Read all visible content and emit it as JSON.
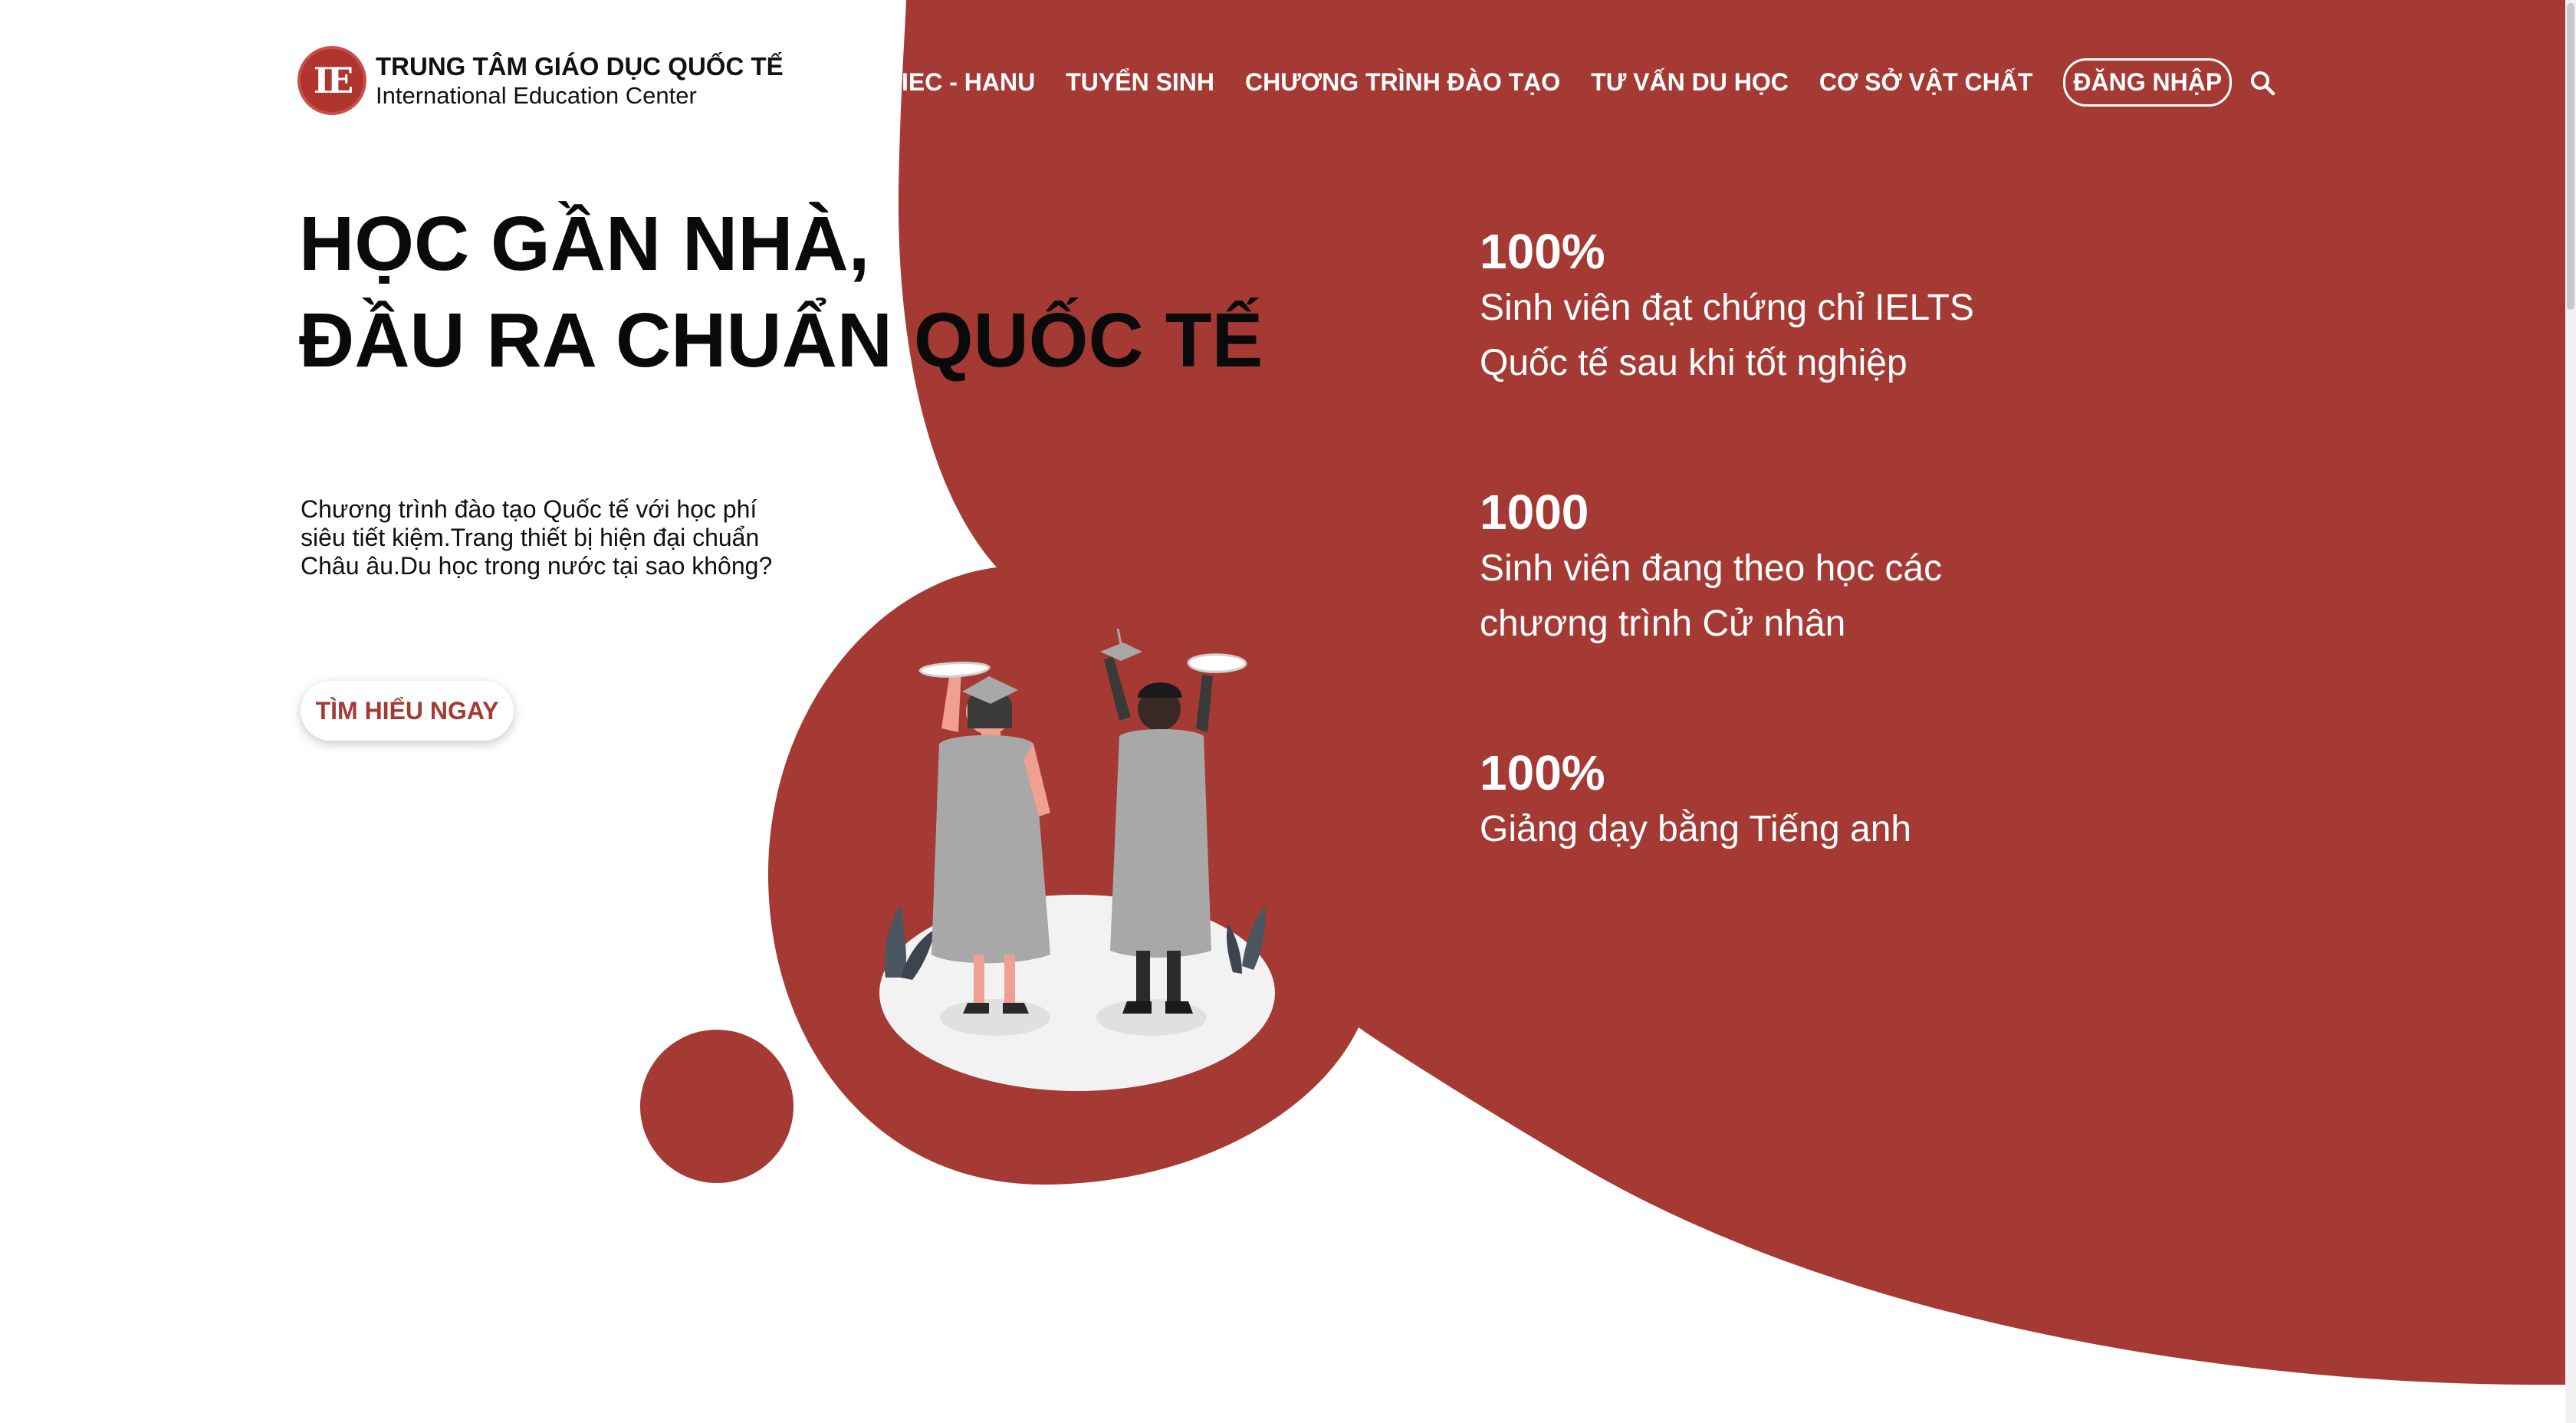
{
  "header": {
    "logo_mark": "IE",
    "logo_title": "TRUNG TÂM GIÁO DỤC QUỐC TẾ",
    "logo_subtitle": "International Education Center",
    "nav": [
      {
        "label": "IEC - HANU"
      },
      {
        "label": "TUYỂN SINH"
      },
      {
        "label": "CHƯƠNG TRÌNH ĐÀO TẠO"
      },
      {
        "label": "TƯ VẤN DU HỌC"
      },
      {
        "label": "CƠ SỞ VẬT CHẤT"
      }
    ],
    "login_label": "ĐĂNG NHẬP",
    "search_icon": "search-icon"
  },
  "hero": {
    "title_line1": "HỌC GẦN NHÀ,",
    "title_line2": "ĐẦU RA CHUẨN QUỐC TẾ",
    "description": "Chương trình đào tạo Quốc tế với học phí siêu tiết kiệm.Trang thiết bị hiện đại chuẩn Châu âu.Du học trong nước tại sao không?",
    "cta_label": "TÌM HIỂU NGAY"
  },
  "stats": [
    {
      "value": "100%",
      "text": "Sinh viên đạt chứng chỉ IELTS\nQuốc tế sau khi tốt nghiệp"
    },
    {
      "value": "1000",
      "text": "Sinh viên đang theo học các\nchương trình Cử nhân"
    },
    {
      "value": "100%",
      "text": "Giảng dạy bằng Tiếng anh"
    }
  ],
  "colors": {
    "brand_red": "#a53a34",
    "text_dark": "#0a0a0a",
    "white": "#ffffff"
  },
  "illustration": "graduates-illustration"
}
